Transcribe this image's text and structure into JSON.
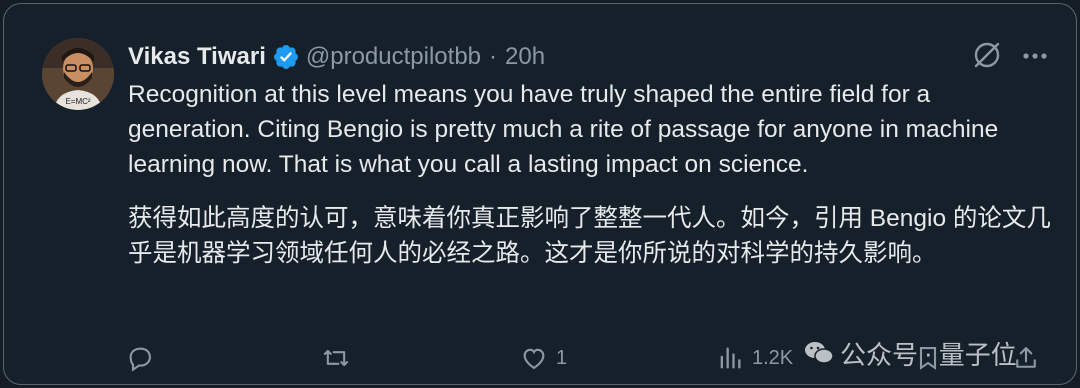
{
  "tweet": {
    "author_name": "Vikas Tiwari",
    "handle": "@productpilotbb",
    "separator": "·",
    "time": "20h",
    "text_en": "Recognition at this level means you have truly shaped the entire field for a generation. Citing Bengio is pretty much a rite of passage for anyone in machine learning now. That is what you call a lasting impact on science.",
    "text_zh": "获得如此高度的认可，意味着你真正影响了整整一代人。如今，引用 Bengio 的论文几乎是机器学习领域任何人的必经之路。这才是你所说的对科学的持久影响。"
  },
  "actions": {
    "likes": "1",
    "views": "1.2K"
  },
  "watermark": {
    "source": "公众号",
    "separator": "·",
    "name": "量子位"
  },
  "avatar_text": "E=MC²",
  "colors": {
    "background": "#15202b",
    "text": "#e7e9ea",
    "muted": "#8b98a5",
    "verified": "#1d9bf0"
  },
  "icons": [
    "verified-badge-icon",
    "grok-icon",
    "more-icon",
    "reply-icon",
    "retweet-icon",
    "like-icon",
    "views-icon",
    "bookmark-icon",
    "share-icon",
    "wechat-icon"
  ]
}
